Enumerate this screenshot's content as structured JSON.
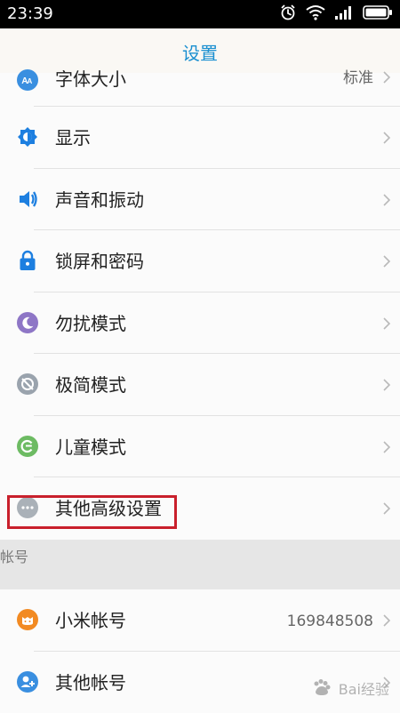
{
  "status_bar": {
    "time": "23:39",
    "icons": [
      "alarm-icon",
      "wifi-icon",
      "signal-icon",
      "battery-icon"
    ]
  },
  "header": {
    "title": "设置"
  },
  "settings_items": [
    {
      "label": "字体大小",
      "value": "标准",
      "icon": "font-size-icon",
      "icon_color": "#3a8fe0"
    },
    {
      "label": "显示",
      "value": "",
      "icon": "display-icon",
      "icon_color": "#1d7fe0"
    },
    {
      "label": "声音和振动",
      "value": "",
      "icon": "sound-icon",
      "icon_color": "#1d7fe0"
    },
    {
      "label": "锁屏和密码",
      "value": "",
      "icon": "lock-icon",
      "icon_color": "#1d7fe0"
    },
    {
      "label": "勿扰模式",
      "value": "",
      "icon": "do-not-disturb-icon",
      "icon_color": "#8e76c6"
    },
    {
      "label": "极简模式",
      "value": "",
      "icon": "minimal-mode-icon",
      "icon_color": "#9aa3ad"
    },
    {
      "label": "儿童模式",
      "value": "",
      "icon": "kids-mode-icon",
      "icon_color": "#6dbb63"
    },
    {
      "label": "其他高级设置",
      "value": "",
      "icon": "more-settings-icon",
      "icon_color": "#aab1b8"
    }
  ],
  "account_section": {
    "title": "帐号",
    "items": [
      {
        "label": "小米帐号",
        "value": "169848508",
        "icon": "mi-account-icon",
        "icon_color": "#f28a22"
      },
      {
        "label": "其他帐号",
        "value": "",
        "icon": "other-account-icon",
        "icon_color": "#3a8fe0"
      }
    ]
  },
  "watermark": {
    "text": "Bai经验"
  }
}
